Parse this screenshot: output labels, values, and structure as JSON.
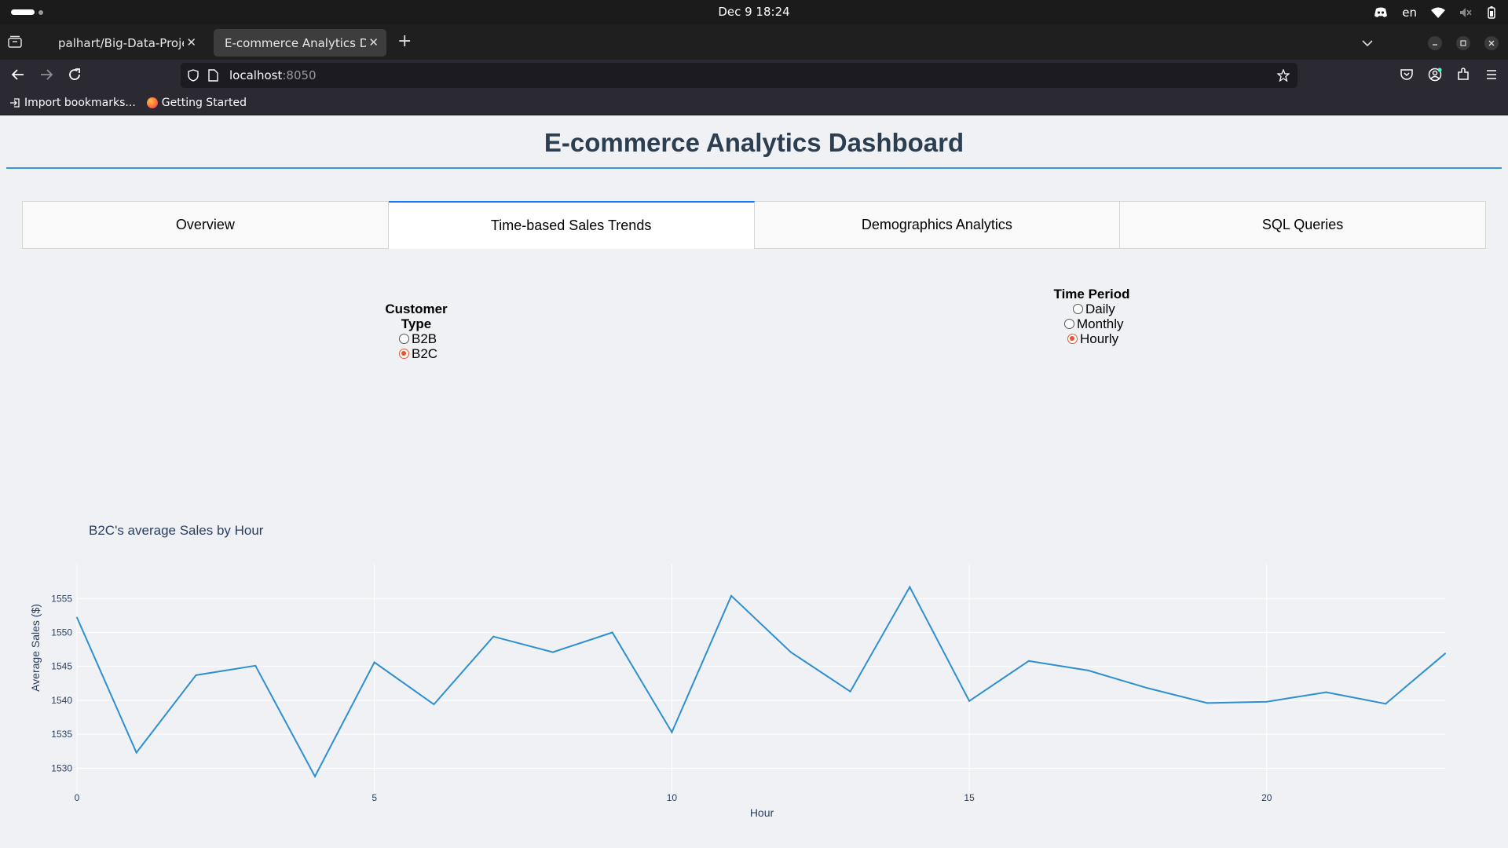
{
  "os": {
    "clock": "Dec 9  18:24",
    "lang": "en"
  },
  "browser": {
    "tabs": [
      {
        "title": "palhart/Big-Data-Project",
        "active": false
      },
      {
        "title": "E-commerce Analytics Dashboard",
        "active": true
      }
    ],
    "url_host": "localhost",
    "url_port": ":8050",
    "bookmarks": [
      {
        "label": "Import bookmarks...",
        "icon": "import-icon"
      },
      {
        "label": "Getting Started",
        "icon": "firefox-icon"
      }
    ]
  },
  "page": {
    "title": "E-commerce Analytics Dashboard",
    "tabs": [
      {
        "label": "Overview",
        "active": false
      },
      {
        "label": "Time-based Sales Trends",
        "active": true
      },
      {
        "label": "Demographics Analytics",
        "active": false
      },
      {
        "label": "SQL Queries",
        "active": false
      }
    ],
    "customer_type": {
      "label": "Customer Type",
      "options": [
        {
          "label": "B2B",
          "checked": false
        },
        {
          "label": "B2C",
          "checked": true
        }
      ]
    },
    "time_period": {
      "label": "Time Period",
      "options": [
        {
          "label": "Daily",
          "checked": false
        },
        {
          "label": "Monthly",
          "checked": false
        },
        {
          "label": "Hourly",
          "checked": true
        }
      ]
    }
  },
  "colors": {
    "accent": "#3498db",
    "line": "#2e8fd0",
    "radio_checked": "#e8542f",
    "title_text": "#2c3e50"
  },
  "chart_data": {
    "type": "line",
    "title": "B2C's average Sales by Hour",
    "xlabel": "Hour",
    "ylabel": "Average Sales ($)",
    "x": [
      0,
      1,
      2,
      3,
      4,
      5,
      6,
      7,
      8,
      9,
      10,
      11,
      12,
      13,
      14,
      15,
      16,
      17,
      18,
      19,
      20,
      21,
      22,
      23
    ],
    "y": [
      1552.2,
      1532.3,
      1543.7,
      1545.1,
      1528.8,
      1545.6,
      1539.4,
      1549.4,
      1547.1,
      1550.0,
      1535.3,
      1555.4,
      1547.1,
      1541.3,
      1556.7,
      1539.9,
      1545.8,
      1544.4,
      1541.8,
      1539.6,
      1539.8,
      1541.2,
      1539.5,
      1546.9
    ],
    "xlim": [
      0,
      23
    ],
    "ylim": [
      1527.5,
      1558.5
    ],
    "xticks": [
      0,
      5,
      10,
      15,
      20
    ],
    "yticks": [
      1530,
      1535,
      1540,
      1545,
      1550,
      1555
    ],
    "grid": true
  }
}
